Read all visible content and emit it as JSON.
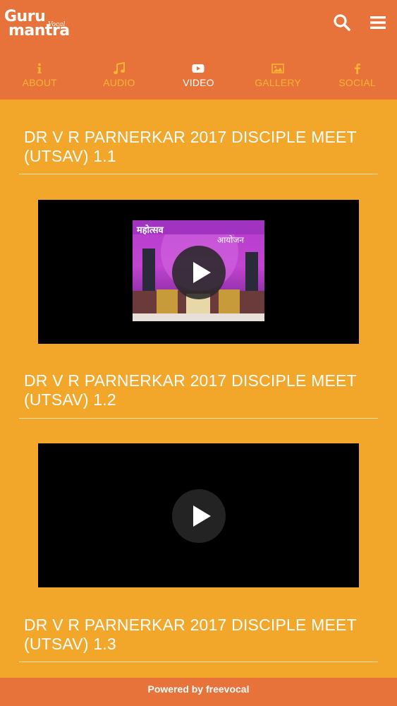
{
  "app": {
    "logo_line1": "Guru",
    "logo_line2": "mantra",
    "logo_script": "Vocal"
  },
  "colors": {
    "header": "#e7733a",
    "background": "#f2a62a",
    "tab_inactive": "#f6b431",
    "tab_active": "#ffffff"
  },
  "tabs": [
    {
      "label": "ABOUT",
      "icon": "info-icon",
      "active": false
    },
    {
      "label": "AUDIO",
      "icon": "music-note-icon",
      "active": false
    },
    {
      "label": "VIDEO",
      "icon": "youtube-play-icon",
      "active": true
    },
    {
      "label": "GALLERY",
      "icon": "image-icon",
      "active": false
    },
    {
      "label": "SOCIAL",
      "icon": "facebook-icon",
      "active": false
    }
  ],
  "videos": [
    {
      "title": "DR V R PARNERKAR 2017 DISCIPLE MEET (UTSAV) 1.1",
      "thumb_text_left": "महोत्सव",
      "thumb_text_right": "आयोजन"
    },
    {
      "title": "DR V R PARNERKAR 2017 DISCIPLE MEET (UTSAV) 1.2"
    },
    {
      "title": "DR V R PARNERKAR 2017 DISCIPLE MEET (UTSAV) 1.3"
    }
  ],
  "footer": {
    "text": "Powered by freevocal"
  }
}
